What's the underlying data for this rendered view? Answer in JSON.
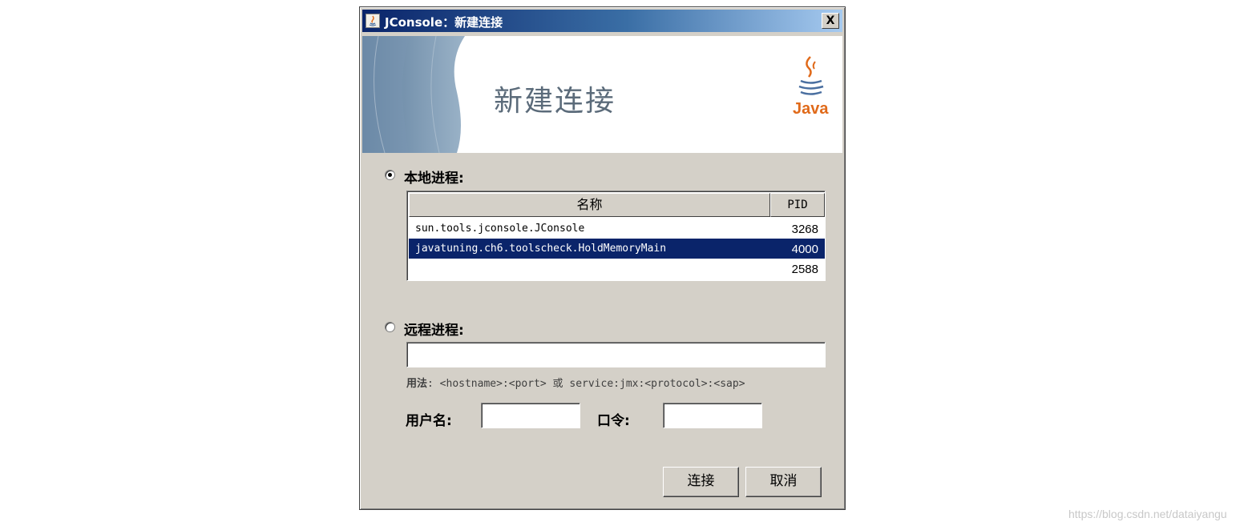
{
  "window": {
    "title": "JConsole：新建连接",
    "close_label": "X"
  },
  "banner": {
    "title": "新建连接",
    "logo_text": "Java"
  },
  "local": {
    "label": "本地进程:",
    "selected": true,
    "columns": {
      "name": "名称",
      "pid": "PID"
    },
    "rows": [
      {
        "name": "sun.tools.jconsole.JConsole",
        "pid": "3268",
        "selected": false
      },
      {
        "name": "javatuning.ch6.toolscheck.HoldMemoryMain",
        "pid": "4000",
        "selected": true
      },
      {
        "name": "",
        "pid": "2588",
        "selected": false
      }
    ]
  },
  "remote": {
    "label": "远程进程:",
    "selected": false,
    "host_value": "",
    "usage_label": "用法",
    "usage_text": ": <hostname>:<port> 或 service:jmx:<protocol>:<sap>",
    "username_label": "用户名:",
    "username_value": "",
    "password_label": "口令:",
    "password_value": ""
  },
  "buttons": {
    "connect": "连接",
    "cancel": "取消"
  },
  "watermark": "https://blog.csdn.net/dataiyangu",
  "colors": {
    "selection": "#0a246a",
    "dialog_bg": "#d4d0c8",
    "java_orange": "#e06a1a"
  }
}
